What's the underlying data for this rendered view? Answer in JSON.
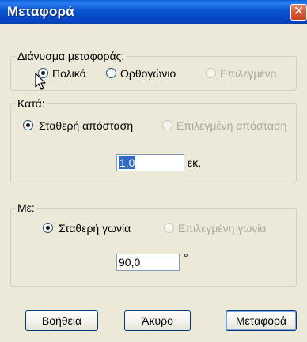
{
  "window": {
    "title": "Μεταφορά",
    "close_glyph": "✕"
  },
  "group1": {
    "legend": "Διάνυσμα μεταφοράς:",
    "options": [
      {
        "label": "Πολικό",
        "checked": true,
        "disabled": false
      },
      {
        "label": "Ορθογώνιο",
        "checked": false,
        "disabled": false
      },
      {
        "label": "Επιλεγμένο",
        "checked": false,
        "disabled": true
      }
    ]
  },
  "group2": {
    "legend": "Κατά:",
    "options": [
      {
        "label": "Σταθερή απόσταση",
        "checked": true,
        "disabled": false
      },
      {
        "label": "Επιλεγμένη απόσταση",
        "checked": false,
        "disabled": true
      }
    ],
    "distance_value": "1,0",
    "unit": "εκ."
  },
  "group3": {
    "legend": "Με:",
    "options": [
      {
        "label": "Σταθερή γωνία",
        "checked": true,
        "disabled": false
      },
      {
        "label": "Επιλεγμένη γωνία",
        "checked": false,
        "disabled": true
      }
    ],
    "angle_value": "90,0",
    "unit": "°"
  },
  "buttons": {
    "help": "Βοήθεια",
    "cancel": "Άκυρο",
    "ok": "Μεταφορά"
  },
  "cursor_icon": "arrow-pointer-icon"
}
